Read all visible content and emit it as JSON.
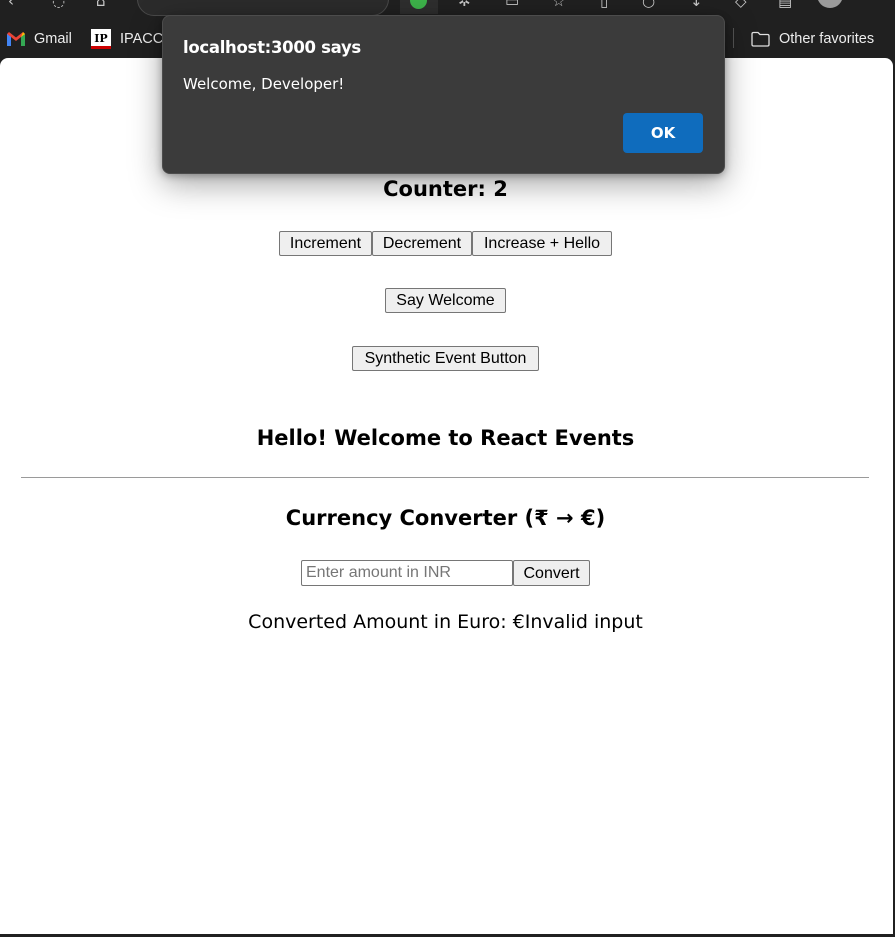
{
  "browser": {
    "bookmarks": [
      {
        "label": "Gmail",
        "icon": "gmail-icon"
      },
      {
        "label": "IPACCT",
        "icon": "ipacct-icon"
      },
      {
        "label": "Other favorites",
        "icon": "folder-icon"
      }
    ]
  },
  "dialog": {
    "title": "localhost:3000 says",
    "message": "Welcome, Developer!",
    "ok_label": "OK",
    "accent": "#0f6cbd"
  },
  "page": {
    "counter_text": "Counter: 2",
    "buttons": {
      "increment": "Increment",
      "decrement": "Decrement",
      "increase_hello": "Increase + Hello",
      "say_welcome": "Say Welcome",
      "synthetic": "Synthetic Event Button"
    },
    "hello_heading": "Hello! Welcome to React Events",
    "currency": {
      "title": "Currency Converter (₹ → €)",
      "placeholder": "Enter amount in INR",
      "convert_label": "Convert",
      "result": "Converted Amount in Euro: €Invalid input"
    }
  }
}
